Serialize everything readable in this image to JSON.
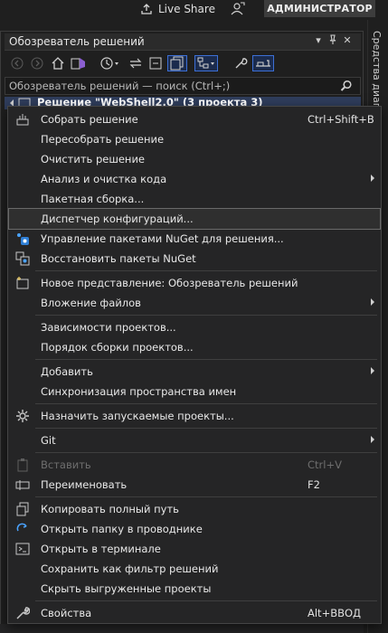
{
  "topbar": {
    "live_share": "Live Share",
    "admin": "АДМИНИСТРАТОР"
  },
  "side_strip": {
    "label": "Средства диагн..."
  },
  "panel": {
    "title": "Обозреватель решений",
    "search_placeholder": "Обозреватель решений — поиск (Ctrl+;)",
    "solution_row": "Решение \"WebShell2.0\" (3 проекта 3)"
  },
  "menu": {
    "items": [
      {
        "label": "Собрать решение",
        "shortcut": "Ctrl+Shift+B",
        "icon": "build-icon"
      },
      {
        "label": "Пересобрать решение",
        "shortcut": ""
      },
      {
        "label": "Очистить решение",
        "shortcut": ""
      },
      {
        "label": "Анализ и очистка кода",
        "shortcut": "",
        "submenu": true
      },
      {
        "label": "Пакетная сборка...",
        "shortcut": ""
      },
      {
        "label": "Диспетчер конфигураций...",
        "shortcut": "",
        "hover": true
      },
      {
        "label": "Управление пакетами NuGet для решения...",
        "shortcut": "",
        "icon": "nuget-icon"
      },
      {
        "label": "Восстановить пакеты NuGet",
        "shortcut": "",
        "icon": "restore-packages-icon"
      },
      {
        "label": "Новое представление: Обозреватель решений",
        "shortcut": "",
        "icon": "new-view-icon"
      },
      {
        "label": "Вложение файлов",
        "shortcut": "",
        "submenu": true
      },
      {
        "label": "Зависимости проектов...",
        "shortcut": ""
      },
      {
        "label": "Порядок сборки проектов...",
        "shortcut": ""
      },
      {
        "label": "Добавить",
        "shortcut": "",
        "submenu": true
      },
      {
        "label": "Синхронизация пространства имен",
        "shortcut": ""
      },
      {
        "label": "Назначить запускаемые проекты...",
        "shortcut": "",
        "icon": "gear-icon"
      },
      {
        "label": "Git",
        "shortcut": "",
        "submenu": true
      },
      {
        "label": "Вставить",
        "shortcut": "Ctrl+V",
        "icon": "paste-icon",
        "disabled": true
      },
      {
        "label": "Переименовать",
        "shortcut": "F2",
        "icon": "rename-icon"
      },
      {
        "label": "Копировать полный путь",
        "shortcut": "",
        "icon": "copy-icon"
      },
      {
        "label": "Открыть папку в проводнике",
        "shortcut": "",
        "icon": "open-folder-icon"
      },
      {
        "label": "Открыть в терминале",
        "shortcut": "",
        "icon": "terminal-icon"
      },
      {
        "label": "Сохранить как фильтр решений",
        "shortcut": ""
      },
      {
        "label": "Скрыть выгруженные проекты",
        "shortcut": ""
      },
      {
        "label": "Свойства",
        "shortcut": "Alt+ВВОД",
        "icon": "wrench-icon"
      }
    ]
  },
  "colors": {
    "background": "#1f1f1f",
    "menu_background": "#252526",
    "selection_border": "#3c6fd6",
    "solution_row_bg": "#2f3d5c"
  }
}
